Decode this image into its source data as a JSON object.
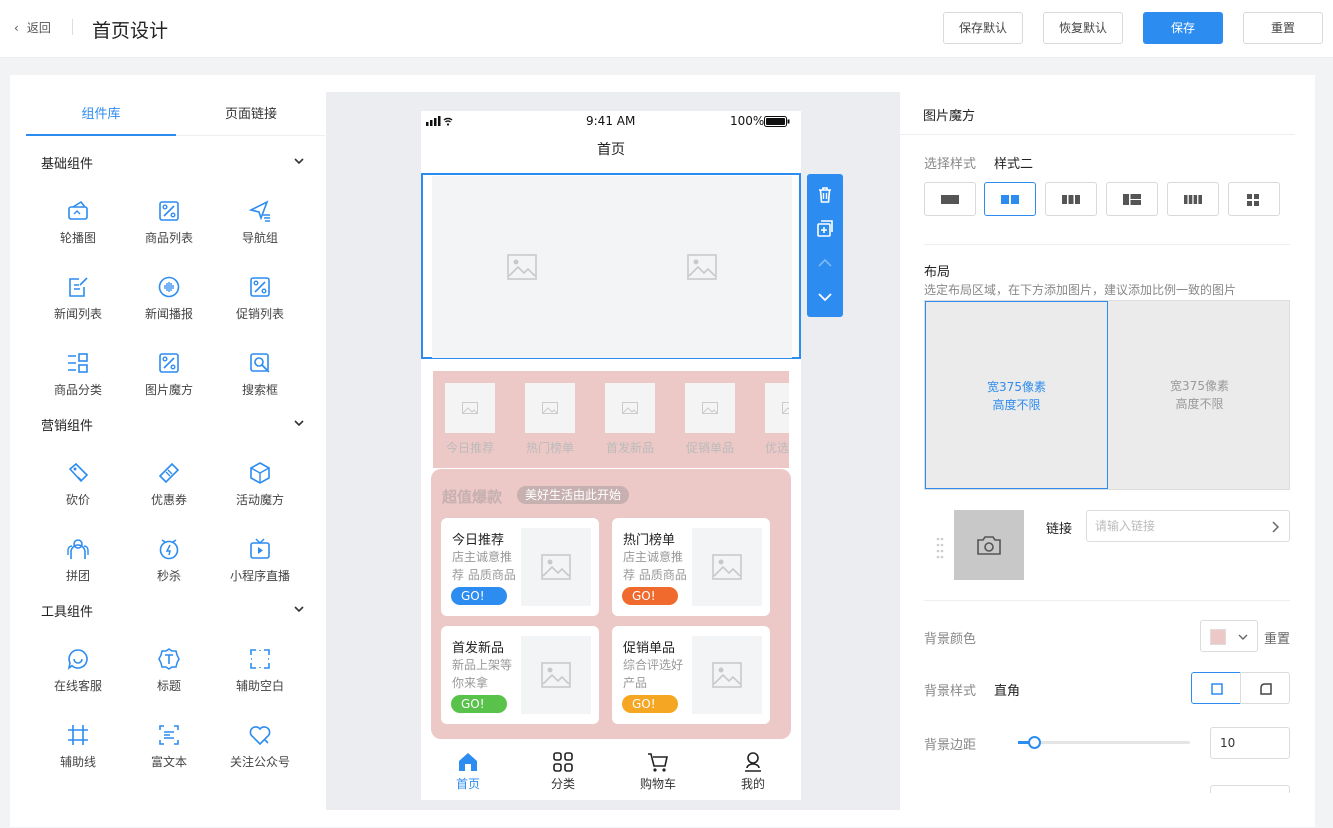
{
  "header": {
    "back_label": "返回",
    "title": "首页设计",
    "buttons": {
      "save_default": "保存默认",
      "restore_default": "恢复默认",
      "save": "保存",
      "reset": "重置"
    }
  },
  "library": {
    "tabs": [
      "组件库",
      "页面链接"
    ],
    "groups": [
      {
        "title": "基础组件",
        "items": [
          {
            "label": "轮播图",
            "icon": "carousel-icon"
          },
          {
            "label": "商品列表",
            "icon": "percent-tag-icon"
          },
          {
            "label": "导航组",
            "icon": "navigation-icon"
          },
          {
            "label": "新闻列表",
            "icon": "news-edit-icon"
          },
          {
            "label": "新闻播报",
            "icon": "broadcast-icon"
          },
          {
            "label": "促销列表",
            "icon": "percent-tag-icon"
          },
          {
            "label": "商品分类",
            "icon": "category-icon"
          },
          {
            "label": "图片魔方",
            "icon": "percent-tag-icon"
          },
          {
            "label": "搜索框",
            "icon": "search-icon"
          }
        ]
      },
      {
        "title": "营销组件",
        "items": [
          {
            "label": "砍价",
            "icon": "bargain-tag-icon"
          },
          {
            "label": "优惠券",
            "icon": "coupon-icon"
          },
          {
            "label": "活动魔方",
            "icon": "cube-icon"
          },
          {
            "label": "拼团",
            "icon": "group-buy-icon"
          },
          {
            "label": "秒杀",
            "icon": "flash-sale-icon"
          },
          {
            "label": "小程序直播",
            "icon": "live-tv-icon"
          }
        ]
      },
      {
        "title": "工具组件",
        "items": [
          {
            "label": "在线客服",
            "icon": "chat-icon"
          },
          {
            "label": "标题",
            "icon": "title-badge-icon"
          },
          {
            "label": "辅助空白",
            "icon": "blank-frame-icon"
          },
          {
            "label": "辅助线",
            "icon": "guide-line-icon"
          },
          {
            "label": "富文本",
            "icon": "rich-text-icon"
          },
          {
            "label": "关注公众号",
            "icon": "follow-heart-icon"
          }
        ]
      }
    ]
  },
  "phone": {
    "status_time": "9:41 AM",
    "battery": "100%",
    "page_title": "首页",
    "nav_items": [
      "今日推荐",
      "热门榜单",
      "首发新品",
      "促销单品",
      "优选"
    ],
    "promo": {
      "heading": "超值爆款",
      "tag": "美好生活由此开始",
      "cards": [
        {
          "title": "今日推荐",
          "desc": "店主诚意推荐 品质商品",
          "go": "GO!",
          "go_color": "#2d8cf0"
        },
        {
          "title": "热门榜单",
          "desc": "店主诚意推荐 品质商品",
          "go": "GO!",
          "go_color": "#f06a2d"
        },
        {
          "title": "首发新品",
          "desc": "新品上架等你来拿",
          "go": "GO!",
          "go_color": "#58c24b"
        },
        {
          "title": "促销单品",
          "desc": "综合评选好产品",
          "go": "GO!",
          "go_color": "#f5a623"
        }
      ]
    },
    "tabbar": [
      {
        "label": "首页",
        "icon": "home-icon",
        "active": true
      },
      {
        "label": "分类",
        "icon": "grid-icon",
        "active": false
      },
      {
        "label": "购物车",
        "icon": "cart-icon",
        "active": false
      },
      {
        "label": "我的",
        "icon": "user-icon",
        "active": false
      }
    ]
  },
  "props": {
    "heading": "图片魔方",
    "style_label": "选择样式",
    "style_value": "样式二",
    "layout_label": "布局",
    "layout_hint": "选定布局区域，在下方添加图片，建议添加比例一致的图片",
    "cells": [
      {
        "line1": "宽375像素",
        "line2": "高度不限"
      },
      {
        "line1": "宽375像素",
        "line2": "高度不限"
      }
    ],
    "link_label": "链接",
    "link_placeholder": "请输入链接",
    "bg_color_label": "背景颜色",
    "bg_color": "#ecc8c7",
    "bg_color_reset": "重置",
    "bg_style_label": "背景样式",
    "bg_style_value": "直角",
    "bg_margin_label": "背景边距",
    "bg_margin_value": "10"
  },
  "colors": {
    "accent": "#2d8cf0",
    "promo_bg": "#ecc8c7"
  }
}
